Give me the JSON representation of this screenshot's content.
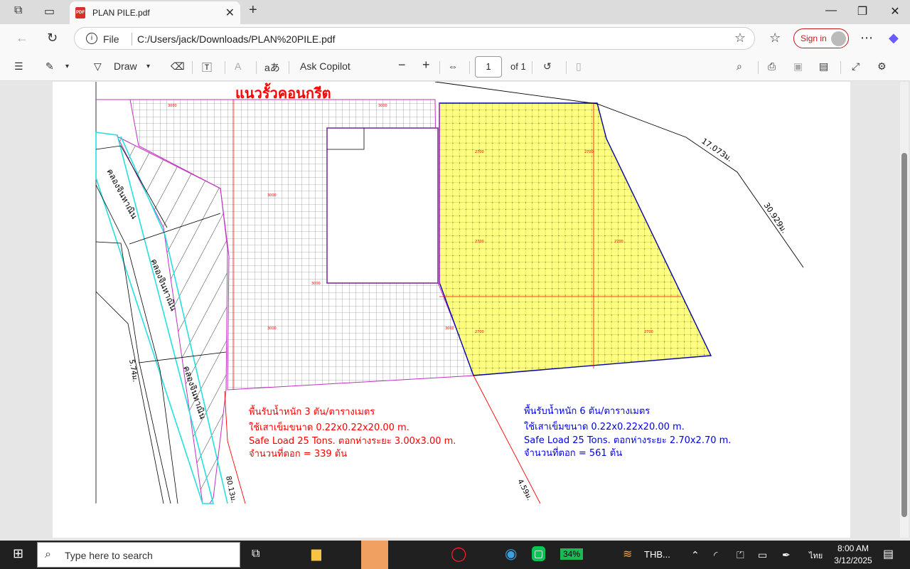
{
  "browser": {
    "tab_title": "PLAN PILE.pdf",
    "file_label": "File",
    "url": "C:/Users/jack/Downloads/PLAN%20PILE.pdf",
    "signin_label": "Sign in"
  },
  "pdf_toolbar": {
    "draw_label": "Draw",
    "read_aloud_glyph": "aあ",
    "ask_copilot_label": "Ask Copilot",
    "page_number": "1",
    "page_total": "of 1"
  },
  "drawing": {
    "header": "แนวรั้วคอนกรีต",
    "red_note": {
      "line1": "พื้นรับน้ำหนัก 3 ตัน/ตารางเมตร",
      "line2": "ใช้เสาเข็มขนาด 0.22x0.22x20.00 m.",
      "line3": "Safe Load 25 Tons. ตอกห่างระยะ 3.00x3.00 m.",
      "line4": "จำนวนที่ตอก = 339 ต้น"
    },
    "blue_note": {
      "line1": "พื้นรับน้ำหนัก 6 ตัน/ตารางเมตร",
      "line2": "ใช้เสาเข็มขนาด 0.22x0.22x20.00 m.",
      "line3": "Safe Load 25 Tons. ตอกห่างระยะ 2.70x2.70 m.",
      "line4": "จำนวนที่ตอก = 561 ต้น"
    },
    "dim1": "17.073ม.",
    "dim2": "30.929ม.",
    "canal1": "คลองจินหาณิน",
    "canal2": "คลองจินหาณิน",
    "canal3": "คลองจินหาณิน",
    "dim_3000": "3000",
    "dim_2700": "2700",
    "edge1": "5.74ม.",
    "edge2": "80.13ม.",
    "edge3": "4.59ม."
  },
  "taskbar": {
    "search_placeholder": "Type here to search",
    "battery": "34%",
    "app_label": "THB...",
    "lang": "ไทย",
    "time": "8:00 AM",
    "date": "3/12/2025"
  }
}
